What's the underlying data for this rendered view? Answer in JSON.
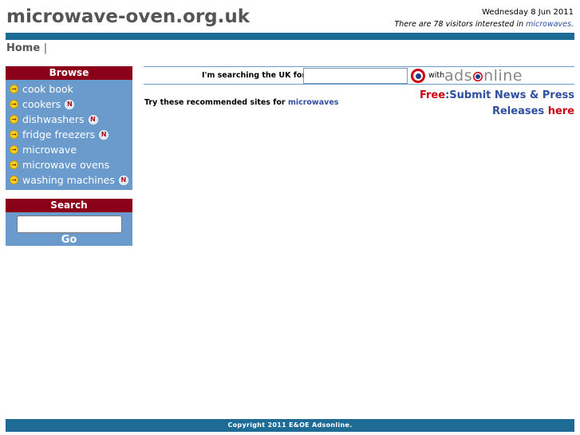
{
  "header": {
    "site_title": "microwave-oven.org.uk",
    "date": "Wednesday 8 Jun 2011",
    "visitors_prefix": "There are 78 visitors interested in ",
    "visitors_link": "microwaves",
    "visitors_suffix": "."
  },
  "nav": {
    "home": "Home",
    "separator": "|"
  },
  "browse": {
    "title": "Browse",
    "items": [
      {
        "label": "cook book",
        "new": false
      },
      {
        "label": "cookers",
        "new": true
      },
      {
        "label": "dishwashers",
        "new": true
      },
      {
        "label": "fridge freezers",
        "new": true
      },
      {
        "label": "microwave",
        "new": false
      },
      {
        "label": "microwave ovens",
        "new": false
      },
      {
        "label": "washing machines",
        "new": true
      }
    ],
    "new_badge": "N",
    "item_icon": "arrow-circle-icon"
  },
  "search": {
    "title": "Search",
    "input_value": "",
    "go_label": "Go"
  },
  "ads": {
    "label": "I'm searching the UK for...",
    "input_value": "",
    "with": "with",
    "logo_pre": "ads",
    "logo_post": "nline"
  },
  "recommend": {
    "prefix": "Try these recommended sites for ",
    "link": "microwaves"
  },
  "promo": {
    "free": "Free",
    "colon_text": ":Submit News & Press",
    "releases": "Releases ",
    "here": "here"
  },
  "footer": {
    "copyright": "Copyright 2011 E&OE Adsonline."
  },
  "colors": {
    "bar_blue": "#1e6b96",
    "sidebar_blue": "#6a9bcc",
    "header_red": "#8b0018",
    "link_blue": "#2f4fa0",
    "accent_red": "#cc0010"
  }
}
